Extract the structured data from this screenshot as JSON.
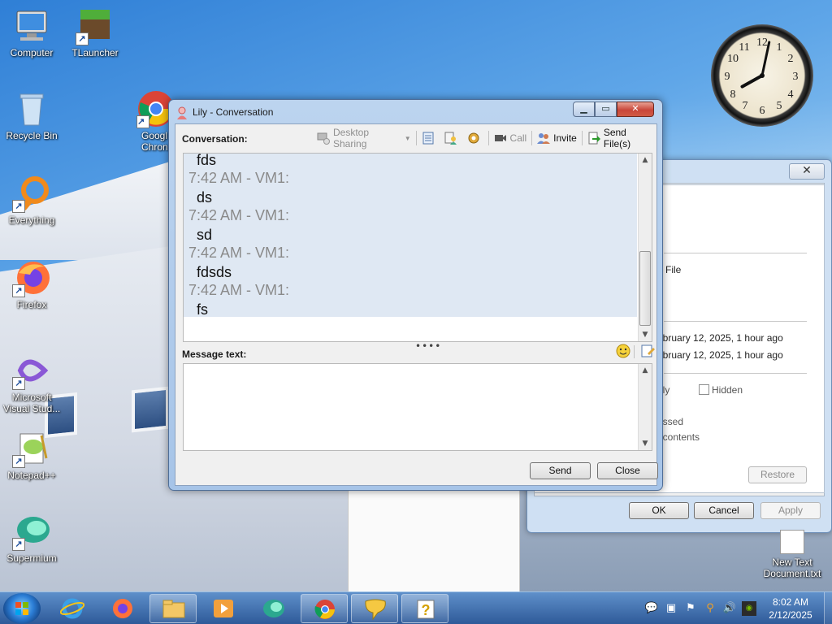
{
  "desktop": {
    "icons": [
      {
        "label": "Computer",
        "icon": "computer-icon"
      },
      {
        "label": "TLauncher",
        "icon": "tlauncher-icon"
      },
      {
        "label": "Recycle Bin",
        "icon": "recycle-bin-icon"
      },
      {
        "label": "Google Chrome",
        "icon": "chrome-icon",
        "visible_label": "Googl Chron"
      },
      {
        "label": "Everything",
        "icon": "everything-icon"
      },
      {
        "label": "Firefox",
        "icon": "firefox-icon"
      },
      {
        "label": "Microsoft Visual Stud...",
        "icon": "visual-studio-icon"
      },
      {
        "label": "Notepad++",
        "icon": "notepad-plus-plus-icon"
      },
      {
        "label": "Supermium",
        "icon": "supermium-icon"
      }
    ],
    "new_text_document": "New Text Document.txt"
  },
  "clock_gadget": {
    "hour": 8,
    "minute": 2
  },
  "properties_dialog": {
    "visible_text": {
      "file_fragment": "File",
      "created": "ebruary 12, 2025, 1 hour ago",
      "modified": "ebruary 12, 2025, 1 hour ago",
      "readonly_fragment": "nly",
      "hidden": "Hidden",
      "compressed_fragment": "essed",
      "contents_fragment": "t contents",
      "restore": "Restore"
    },
    "buttons": {
      "ok": "OK",
      "cancel": "Cancel",
      "apply": "Apply"
    }
  },
  "conversation": {
    "title": "Lily - Conversation",
    "conversation_label": "Conversation:",
    "toolbar": {
      "desktop_sharing": "Desktop Sharing",
      "call": "Call",
      "invite": "Invite",
      "send_files": "Send File(s)"
    },
    "messages": [
      {
        "meta": "",
        "text": "fds"
      },
      {
        "meta": "7:42 AM - VM1:",
        "text": "ds"
      },
      {
        "meta": "7:42 AM - VM1:",
        "text": "sd"
      },
      {
        "meta": "7:42 AM - VM1:",
        "text": "fdsds"
      },
      {
        "meta": "7:42 AM - VM1:",
        "text": "fs"
      }
    ],
    "message_label": "Message text:",
    "message_value": "",
    "send_button": "Send",
    "close_button": "Close"
  },
  "taskbar": {
    "pinned": [
      "internet-explorer-icon",
      "firefox-icon",
      "file-explorer-icon",
      "media-player-icon",
      "supermium-icon",
      "chrome-icon",
      "messenger-icon",
      "help-icon"
    ],
    "time": "8:02 AM",
    "date": "2/12/2025"
  }
}
